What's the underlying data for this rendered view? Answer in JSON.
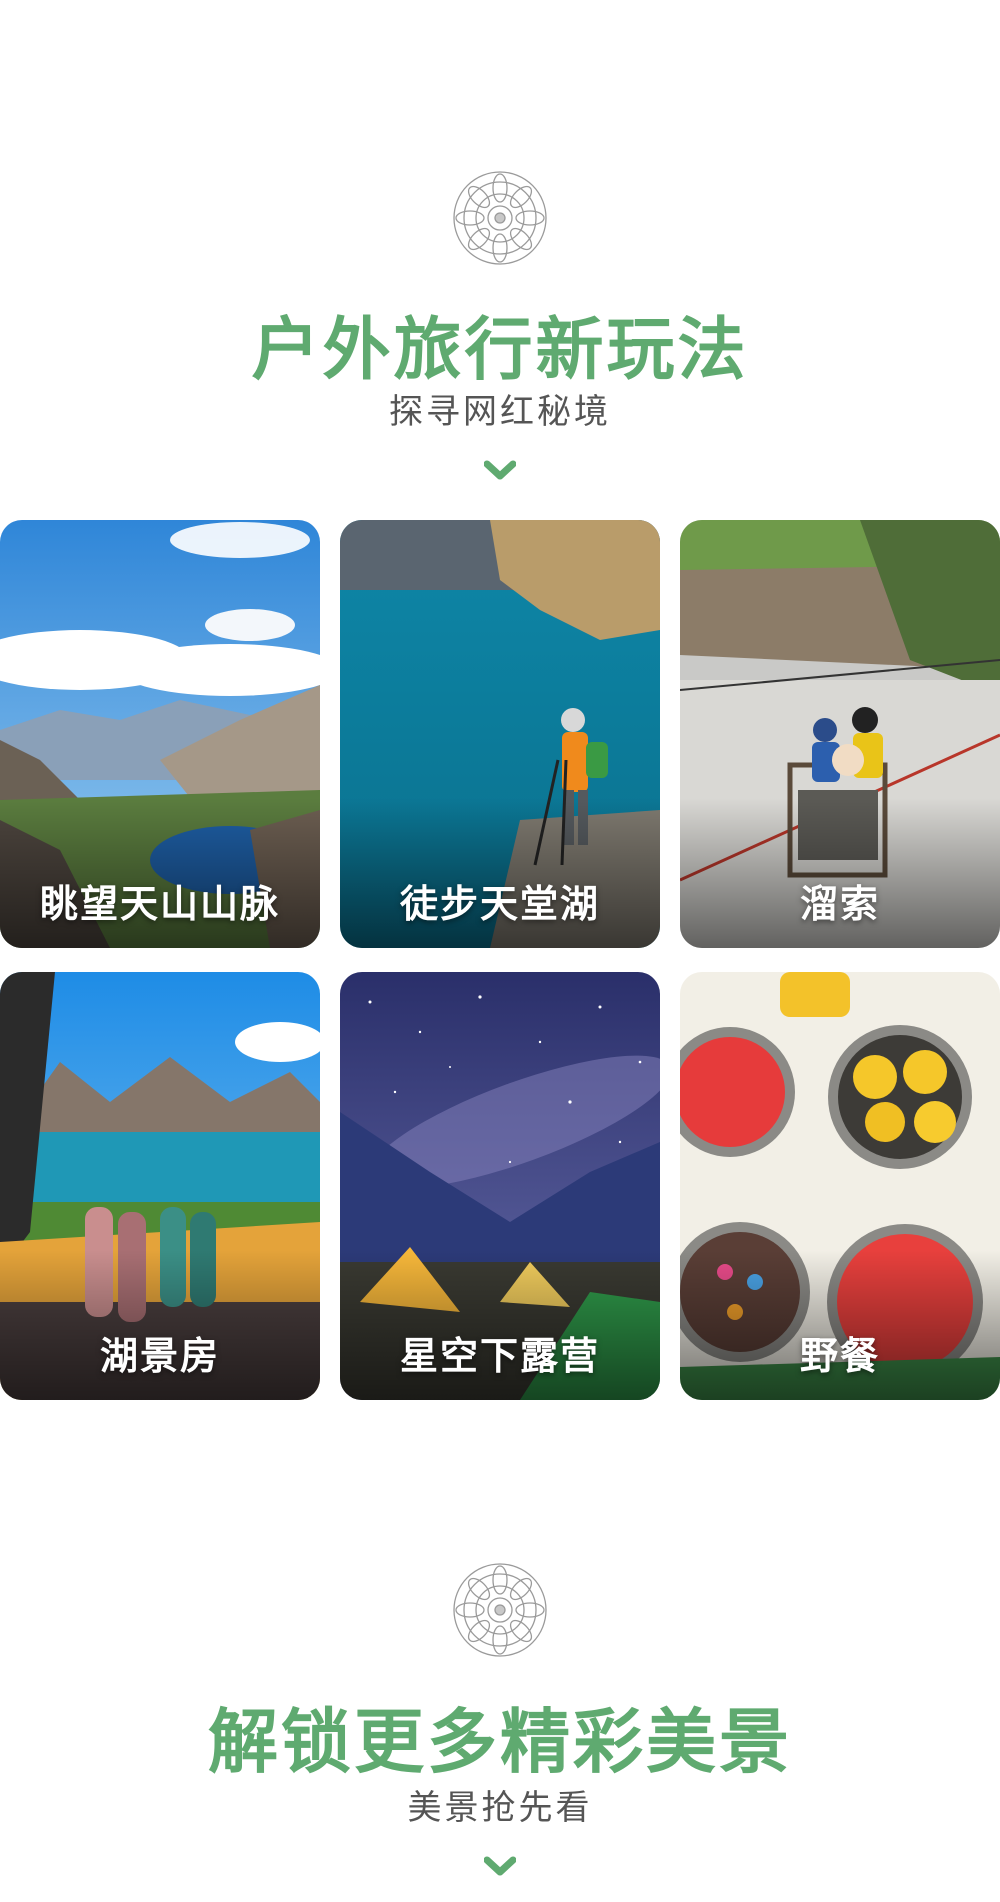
{
  "section1": {
    "title": "户外旅行新玩法",
    "subtitle": "探寻网红秘境",
    "ornament_icon": "mandala-ornament-icon",
    "arrow_icon": "chevron-down-icon"
  },
  "cards": [
    {
      "label": "眺望天山山脉",
      "scene": "snowy mountain range above a blue alpine lake"
    },
    {
      "label": "徒步天堂湖",
      "scene": "hiker with poles standing beside a turquoise lake"
    },
    {
      "label": "溜索",
      "scene": "people in a basket crossing a river on a zipline"
    },
    {
      "label": "湖景房",
      "scene": "view from a tent of feet in socks facing a lake"
    },
    {
      "label": "星空下露营",
      "scene": "glowing tents under a starry night sky"
    },
    {
      "label": "野餐",
      "scene": "bowls of watermelon, lemons and candy on a picnic cloth"
    }
  ],
  "section2": {
    "title": "解锁更多精彩美景",
    "subtitle": "美景抢先看",
    "ornament_icon": "mandala-ornament-icon",
    "arrow_icon": "chevron-down-icon"
  },
  "colors": {
    "accent_green": "#5faa70",
    "subtitle_gray": "#555555",
    "background": "#ffffff"
  }
}
